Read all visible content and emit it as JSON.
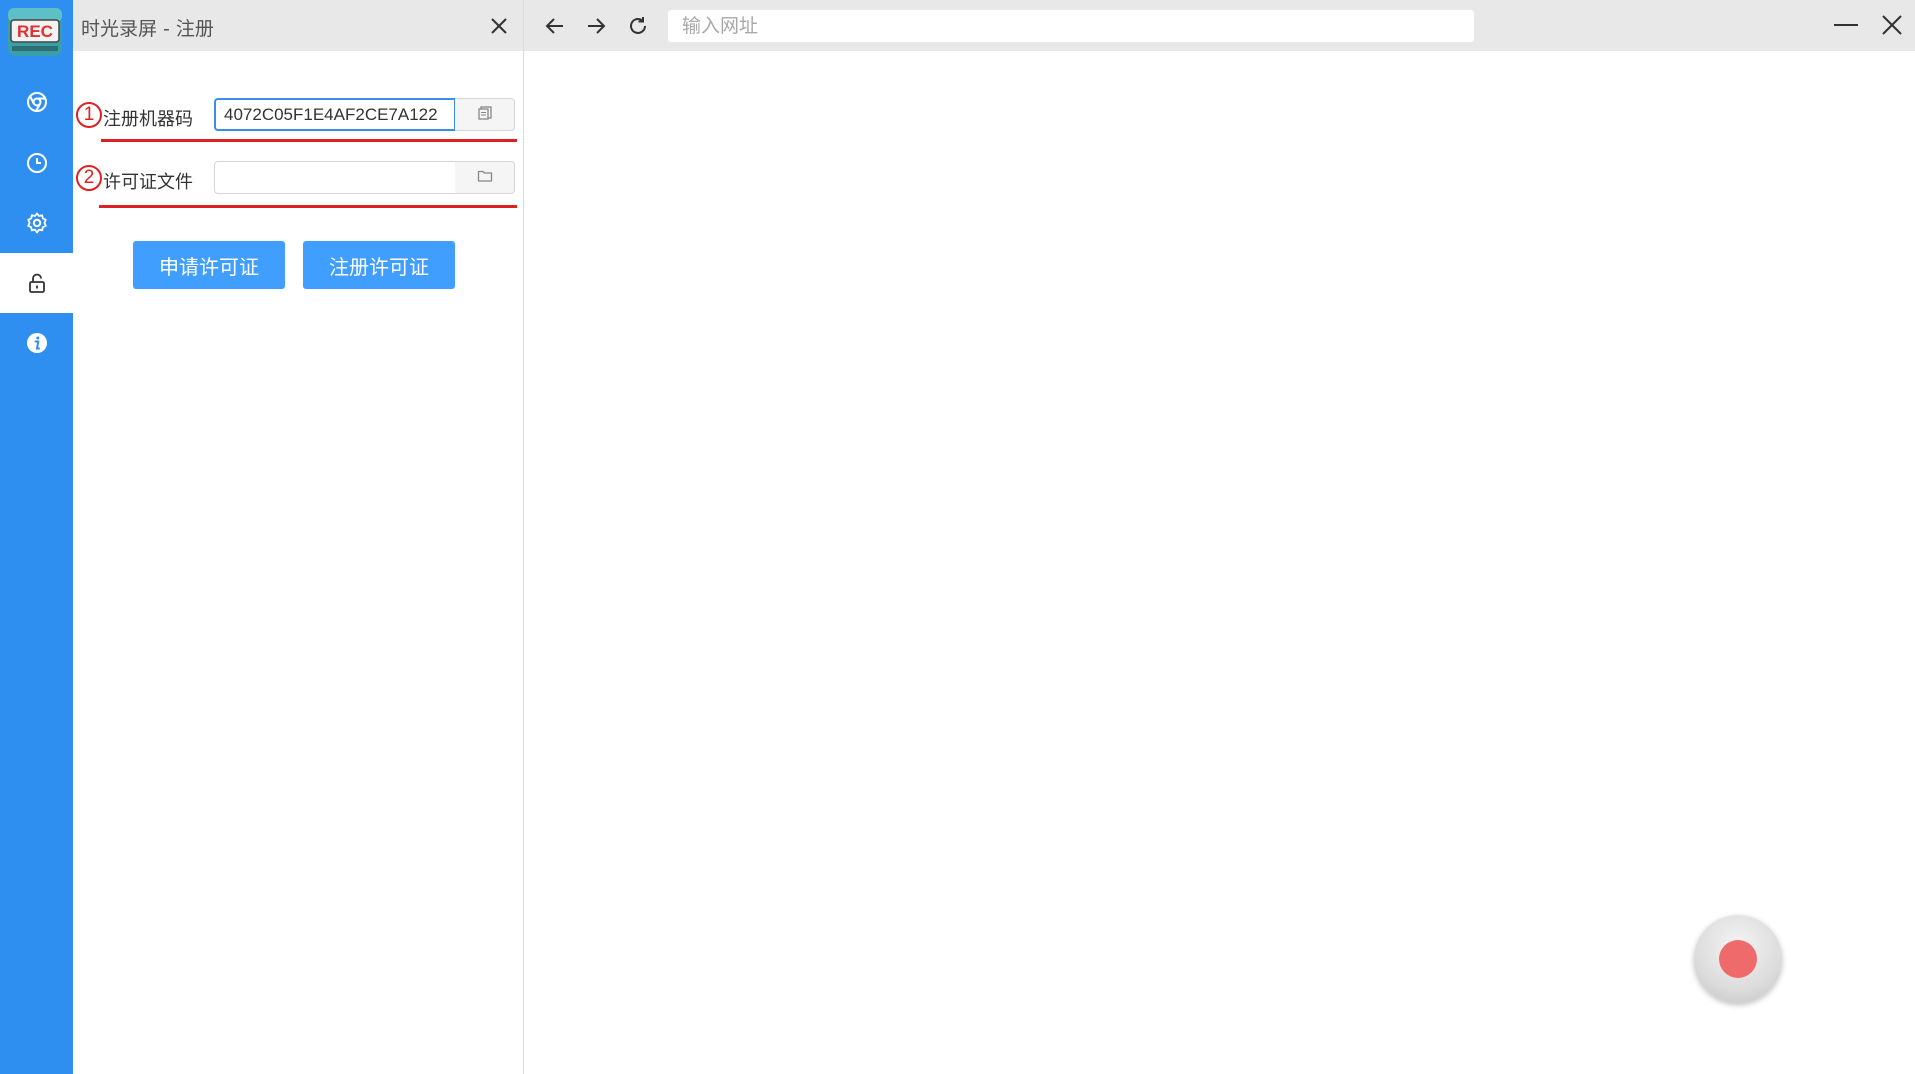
{
  "app": {
    "logo_text": "REC"
  },
  "rail": {
    "items": [
      {
        "icon": "chrome-icon",
        "active": false
      },
      {
        "icon": "clock-icon",
        "active": false
      },
      {
        "icon": "gear-icon",
        "active": false
      },
      {
        "icon": "unlock-icon",
        "active": true
      },
      {
        "icon": "info-icon",
        "active": false
      }
    ]
  },
  "panel": {
    "title": "时光录屏 - 注册",
    "fields": [
      {
        "badge": "1",
        "label": "注册机器码",
        "value": "4072C05F1E4AF2CE7A122",
        "button_icon": "copy-icon"
      },
      {
        "badge": "2",
        "label": "许可证文件",
        "value": "",
        "button_icon": "folder-icon"
      }
    ],
    "apply_button": "申请许可证",
    "register_button": "注册许可证"
  },
  "browser": {
    "url_placeholder": "输入网址",
    "nav": [
      "back-arrow-icon",
      "forward-arrow-icon",
      "refresh-icon"
    ]
  },
  "colors": {
    "rail": "#2f8ff0",
    "primary_button": "#409eff",
    "annotation": "#e02020",
    "record": "#ef6b6b"
  }
}
